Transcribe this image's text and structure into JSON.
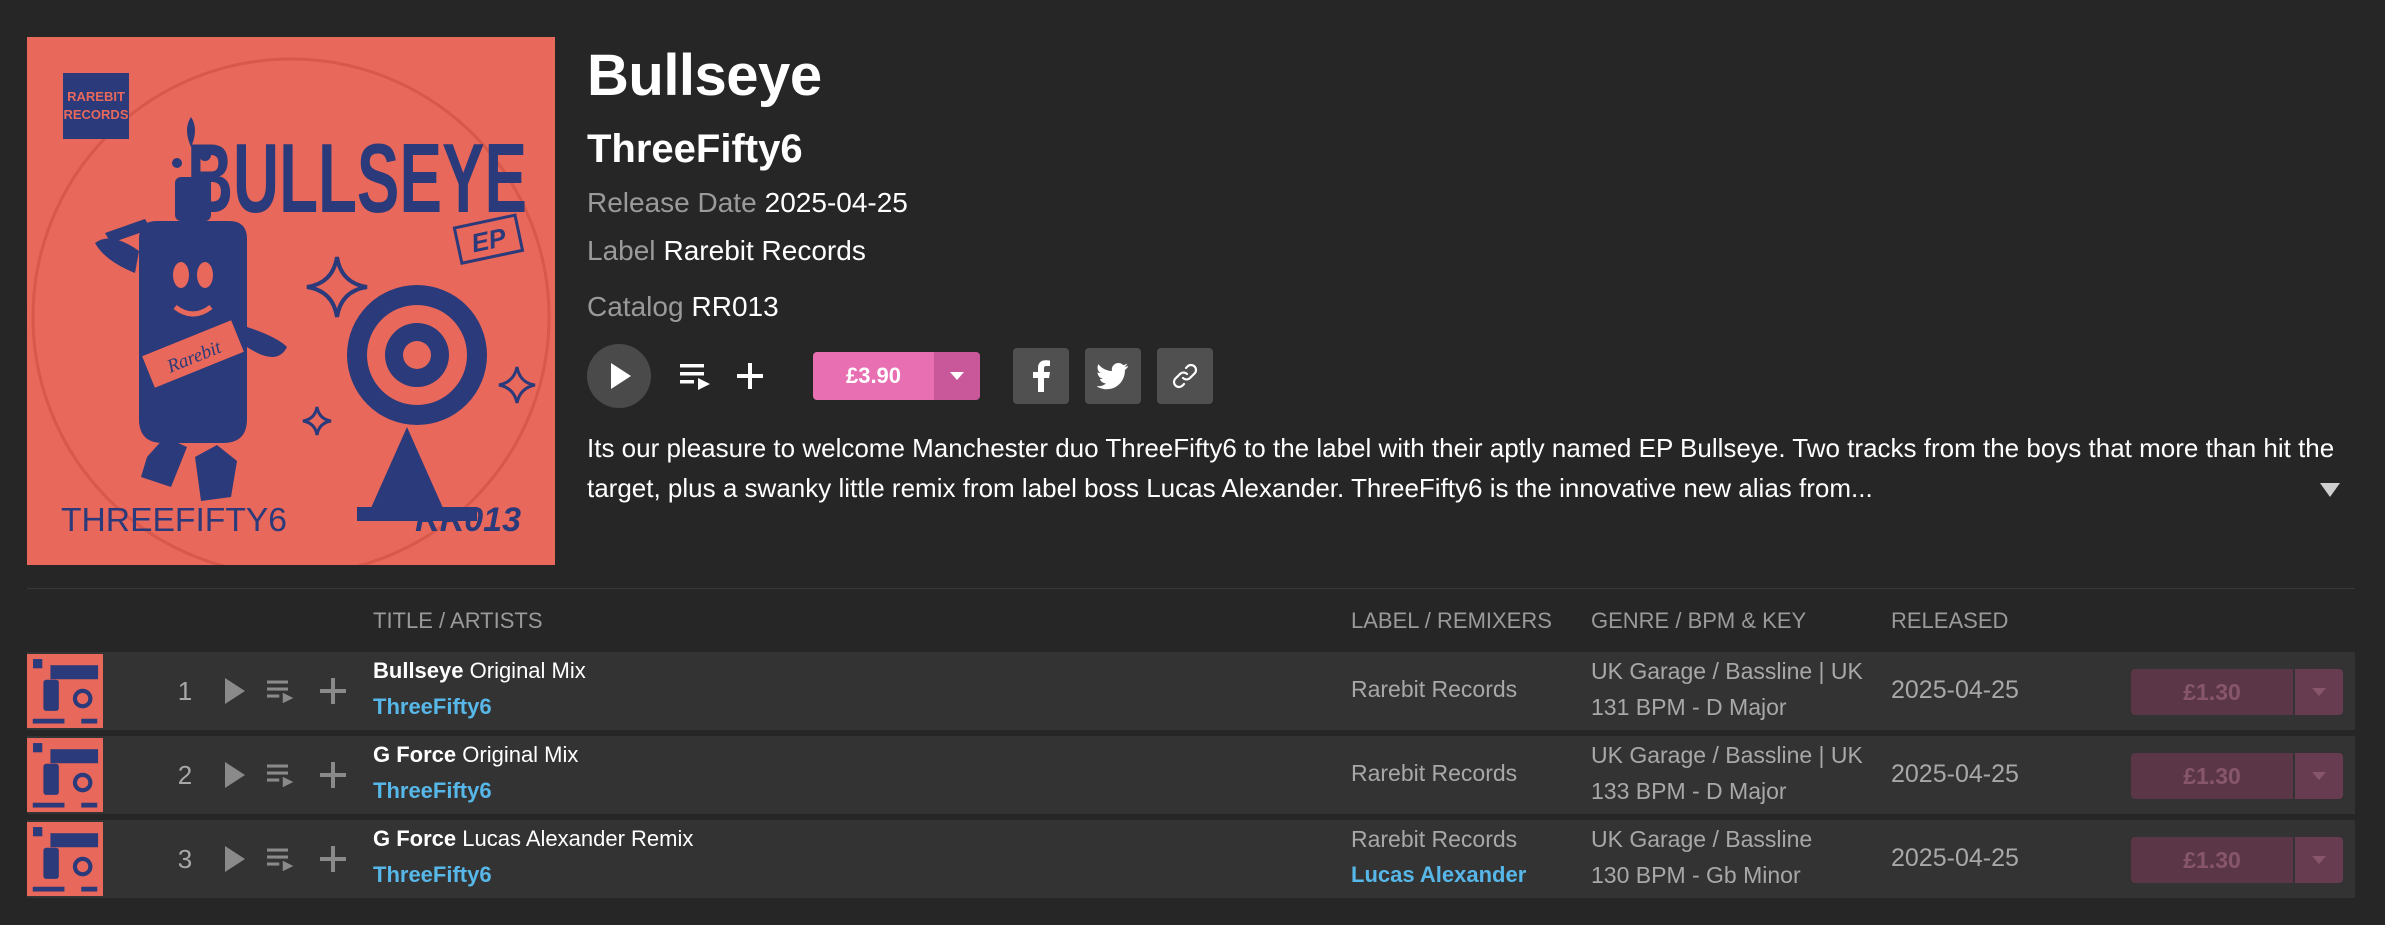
{
  "release": {
    "title": "Bullseye",
    "artist": "ThreeFifty6",
    "release_date_label": "Release Date",
    "release_date": "2025-04-25",
    "label_label": "Label",
    "label": "Rarebit Records",
    "catalog_label": "Catalog",
    "catalog": "RR013",
    "price": "£3.90",
    "description_line1": "Its our pleasure to welcome Manchester duo ThreeFifty6 to the label with their aptly named EP Bullseye. Two tracks from the boys that more than hit the",
    "description_line2": "target, plus a swanky little remix from label boss Lucas Alexander. ThreeFifty6 is the innovative new alias from..."
  },
  "cover_art": {
    "label_logo_line1": "RAREBIT",
    "label_logo_line2": "RECORDS",
    "title": "BULLSEYE",
    "ep": "EP",
    "artist": "THREEFIFTY6",
    "catalog": "RR013",
    "bottle_text": "Rarebit"
  },
  "table": {
    "headers": {
      "title": "TITLE / ARTISTS",
      "label": "LABEL / REMIXERS",
      "genre": "GENRE / BPM & KEY",
      "released": "RELEASED"
    },
    "tracks": [
      {
        "num": "1",
        "name": "Bullseye",
        "mix": "Original Mix",
        "artist": "ThreeFifty6",
        "label": "Rarebit Records",
        "remixer": "",
        "genre": "UK Garage / Bassline | UK Garage",
        "bpm_key": "131 BPM - D Major",
        "released": "2025-04-25",
        "price": "£1.30"
      },
      {
        "num": "2",
        "name": "G Force",
        "mix": "Original Mix",
        "artist": "ThreeFifty6",
        "label": "Rarebit Records",
        "remixer": "",
        "genre": "UK Garage / Bassline | UK Garage",
        "bpm_key": "133 BPM - D Major",
        "released": "2025-04-25",
        "price": "£1.30"
      },
      {
        "num": "3",
        "name": "G Force",
        "mix": "Lucas Alexander Remix",
        "artist": "ThreeFifty6",
        "label": "Rarebit Records",
        "remixer": "Lucas Alexander",
        "genre": "UK Garage / Bassline",
        "bpm_key": "130 BPM - Gb Minor",
        "released": "2025-04-25",
        "price": "£1.30"
      }
    ]
  },
  "icons": {
    "play": "play-icon",
    "queue": "add-to-queue-icon",
    "add": "plus-icon",
    "dropdown": "chevron-down-icon",
    "facebook": "facebook-icon",
    "twitter": "twitter-icon",
    "link": "link-icon",
    "expand": "triangle-down-icon"
  },
  "colors": {
    "background": "#262626",
    "row_background": "#333333",
    "accent_pink": "#e86fb1",
    "link_blue": "#57b7e8",
    "cover_red": "#e8685b",
    "cover_navy": "#2b3a7a"
  }
}
